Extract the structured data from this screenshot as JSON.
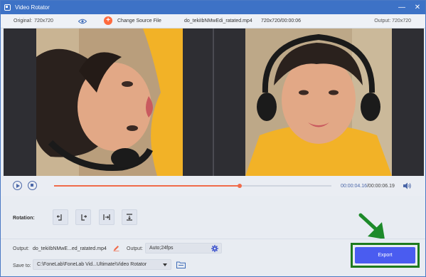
{
  "window": {
    "title": "Video Rotator",
    "minimize": "—",
    "close": "✕"
  },
  "header": {
    "original_label": "Original:",
    "original_value": "720x720",
    "change_source_label": "Change Source File",
    "file_name": "do_tekiIbNMwEdi_ratated.mp4",
    "file_info": "720x720/00:00:06",
    "output_res": "Output: 720x720"
  },
  "playback": {
    "current_time": "00:00:04.16",
    "total_time": "/00:00:06.19",
    "progress": 0.67
  },
  "rotation": {
    "label": "Rotation:"
  },
  "output": {
    "label": "Output:",
    "file_name": "do_tekiIbNMwE...ed_ratated.mp4",
    "format_label": "Output:",
    "format_value": "Auto;24fps"
  },
  "save": {
    "label": "Save to:",
    "path": "C:\\FoneLab\\FoneLab Vid...Ultimate\\Video Rotator"
  },
  "export": {
    "label": "Export"
  },
  "colors": {
    "accent": "#4a5cf0",
    "progress": "#f06b4a",
    "titlebar": "#3d72c6",
    "highlight": "#1d7a1d"
  }
}
